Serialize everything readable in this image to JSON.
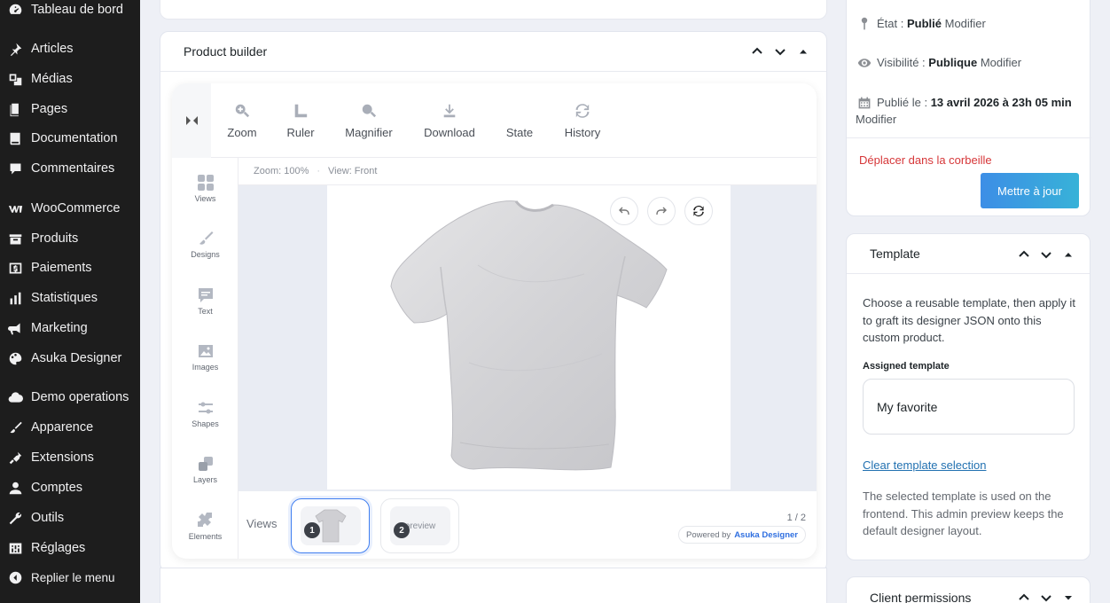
{
  "sidebar": {
    "items": [
      {
        "label": "Tableau de bord",
        "icon": "dashboard-icon"
      },
      {
        "label": "Articles",
        "icon": "pin-icon"
      },
      {
        "label": "Médias",
        "icon": "media-icon"
      },
      {
        "label": "Pages",
        "icon": "pages-icon"
      },
      {
        "label": "Documentation",
        "icon": "book-icon"
      },
      {
        "label": "Commentaires",
        "icon": "comment-icon"
      },
      {
        "label": "WooCommerce",
        "icon": "woo-icon"
      },
      {
        "label": "Produits",
        "icon": "archive-icon"
      },
      {
        "label": "Paiements",
        "icon": "payments-icon"
      },
      {
        "label": "Statistiques",
        "icon": "chart-bar-icon"
      },
      {
        "label": "Marketing",
        "icon": "megaphone-icon"
      },
      {
        "label": "Asuka Designer",
        "icon": "palette-icon"
      },
      {
        "label": "Demo operations",
        "icon": "cloud-icon"
      },
      {
        "label": "Apparence",
        "icon": "brush-icon"
      },
      {
        "label": "Extensions",
        "icon": "plugin-icon"
      },
      {
        "label": "Comptes",
        "icon": "user-icon"
      },
      {
        "label": "Outils",
        "icon": "wrench-icon"
      },
      {
        "label": "Réglages",
        "icon": "settings-icon"
      },
      {
        "label": "Replier le menu",
        "icon": "collapse-icon"
      }
    ]
  },
  "product_builder": {
    "title": "Product builder",
    "toolbar": [
      {
        "label": "Zoom",
        "icon": "zoom-icon"
      },
      {
        "label": "Ruler",
        "icon": "ruler-icon"
      },
      {
        "label": "Magnifier",
        "icon": "magnifier-icon"
      },
      {
        "label": "Download",
        "icon": "download-icon"
      },
      {
        "label": "State",
        "icon": "state-icon"
      },
      {
        "label": "History",
        "icon": "history-icon"
      }
    ],
    "left_tabs": [
      {
        "label": "Views",
        "icon": "views-icon"
      },
      {
        "label": "Designs",
        "icon": "designs-icon"
      },
      {
        "label": "Text",
        "icon": "text-icon"
      },
      {
        "label": "Images",
        "icon": "images-icon"
      },
      {
        "label": "Shapes",
        "icon": "shapes-icon"
      },
      {
        "label": "Layers",
        "icon": "layers-icon"
      },
      {
        "label": "Elements",
        "icon": "elements-icon"
      }
    ],
    "info": {
      "zoom": "Zoom: 100%",
      "sep": "·",
      "view": "View: Front"
    },
    "views": {
      "label": "Views",
      "thumbs": [
        {
          "number": "1",
          "text": ""
        },
        {
          "number": "2",
          "text": "preview"
        }
      ],
      "pager": "1 / 2",
      "powered_prefix": "Powered by",
      "powered_brand": "Asuka Designer"
    }
  },
  "publish": {
    "status_label": "État : ",
    "status_value": "Publié",
    "status_link": "Modifier",
    "visibility_label": "Visibilité : ",
    "visibility_value": "Publique",
    "visibility_link": "Modifier",
    "published_label": "Publié le : ",
    "published_value": "13 avril 2026 à 23h 05 min",
    "published_link": "Modifier",
    "trash": "Déplacer dans la corbeille",
    "update_button": "Mettre à jour"
  },
  "template": {
    "title": "Template",
    "description": "Choose a reusable template, then apply it to graft its designer JSON onto this custom product.",
    "assigned_label": "Assigned template",
    "assigned_value": "My favorite",
    "clear_link": "Clear template selection",
    "note": "The selected template is used on the frontend. This admin preview keeps the default designer layout."
  },
  "permissions": {
    "title": "Client permissions"
  },
  "colors": {
    "sidebar_bg": "#1d1d1d",
    "accent": "#3f7ef0",
    "trash": "#d63638",
    "button_start": "#3d8ee6",
    "button_end": "#37b2d8"
  }
}
